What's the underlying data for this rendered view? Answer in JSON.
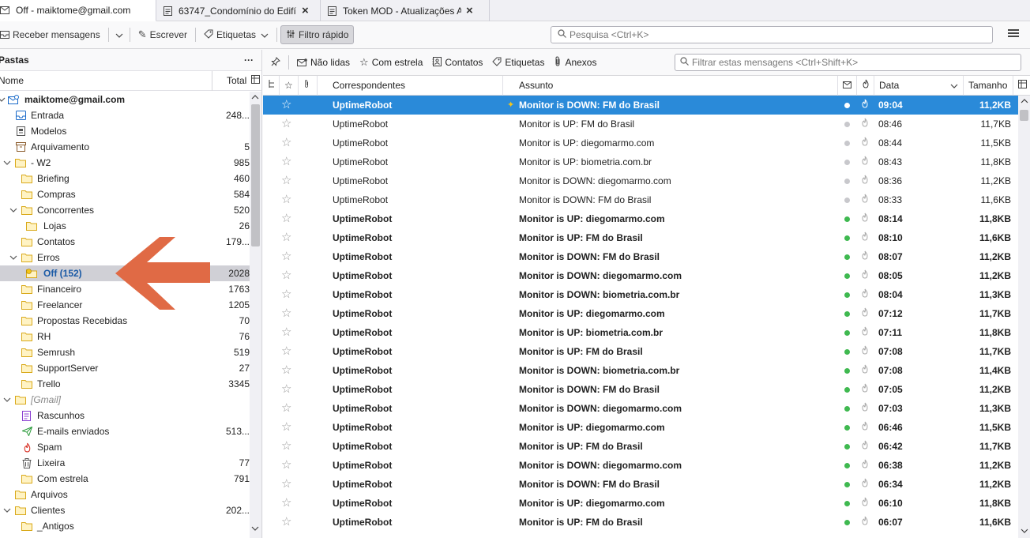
{
  "tabs": [
    {
      "label": "Off - maiktome@gmail.com",
      "icon": "mail-icon",
      "active": true
    },
    {
      "label": "63747_Condomínio do Edifí",
      "icon": "document-icon",
      "active": false
    },
    {
      "label": "Token MOD - Atualizações A",
      "icon": "document-icon",
      "active": false
    }
  ],
  "toolbar": {
    "get_messages": "Receber mensagens",
    "write": "Escrever",
    "tags": "Etiquetas",
    "quick_filter": "Filtro rápido",
    "search_placeholder": "Pesquisa <Ctrl+K>"
  },
  "folder_pane": {
    "title": "Pastas",
    "more": "···",
    "col_name": "Nome",
    "col_total": "Total",
    "folders": [
      {
        "name": "maiktome@gmail.com",
        "count": "",
        "icon": "account-icon",
        "twisty": "v",
        "indent": 0,
        "bold": true
      },
      {
        "name": "Entrada",
        "count": "248...",
        "icon": "inbox-icon",
        "twisty": "",
        "indent": 1
      },
      {
        "name": "Modelos",
        "count": "",
        "icon": "templates-icon",
        "twisty": "",
        "indent": 1
      },
      {
        "name": "Arquivamento",
        "count": "5",
        "icon": "archive-icon",
        "twisty": "",
        "indent": 1
      },
      {
        "name": "- W2",
        "count": "985",
        "icon": "folder-icon",
        "twisty": "v",
        "indent": 1
      },
      {
        "name": "Briefing",
        "count": "460",
        "icon": "folder-icon",
        "twisty": "",
        "indent": 2
      },
      {
        "name": "Compras",
        "count": "584",
        "icon": "folder-icon",
        "twisty": "",
        "indent": 2
      },
      {
        "name": "Concorrentes",
        "count": "520",
        "icon": "folder-icon",
        "twisty": "v",
        "indent": 2
      },
      {
        "name": "Lojas",
        "count": "26",
        "icon": "folder-icon",
        "twisty": "",
        "indent": 3
      },
      {
        "name": "Contatos",
        "count": "179...",
        "icon": "folder-icon",
        "twisty": "",
        "indent": 2
      },
      {
        "name": "Erros",
        "count": "",
        "icon": "folder-icon",
        "twisty": "v",
        "indent": 2
      },
      {
        "name": "Off (152)",
        "count": "2028",
        "icon": "folder-new-icon",
        "twisty": "",
        "indent": 3,
        "selected": true
      },
      {
        "name": "Financeiro",
        "count": "1763",
        "icon": "folder-icon",
        "twisty": "",
        "indent": 2
      },
      {
        "name": "Freelancer",
        "count": "1205",
        "icon": "folder-icon",
        "twisty": "",
        "indent": 2
      },
      {
        "name": "Propostas Recebidas",
        "count": "70",
        "icon": "folder-icon",
        "twisty": "",
        "indent": 2
      },
      {
        "name": "RH",
        "count": "76",
        "icon": "folder-icon",
        "twisty": "",
        "indent": 2
      },
      {
        "name": "Semrush",
        "count": "519",
        "icon": "folder-icon",
        "twisty": "",
        "indent": 2
      },
      {
        "name": "SupportServer",
        "count": "27",
        "icon": "folder-icon",
        "twisty": "",
        "indent": 2
      },
      {
        "name": "Trello",
        "count": "3345",
        "icon": "folder-icon",
        "twisty": "",
        "indent": 2
      },
      {
        "name": "[Gmail]",
        "count": "",
        "icon": "folder-icon",
        "twisty": "v",
        "indent": 1,
        "italic": true
      },
      {
        "name": "Rascunhos",
        "count": "",
        "icon": "drafts-icon",
        "twisty": "",
        "indent": 2
      },
      {
        "name": "E-mails enviados",
        "count": "513...",
        "icon": "sent-icon",
        "twisty": "",
        "indent": 2
      },
      {
        "name": "Spam",
        "count": "",
        "icon": "spam-icon",
        "twisty": "",
        "indent": 2
      },
      {
        "name": "Lixeira",
        "count": "77",
        "icon": "trash-icon",
        "twisty": "",
        "indent": 2
      },
      {
        "name": "Com estrela",
        "count": "791",
        "icon": "folder-icon",
        "twisty": "",
        "indent": 2
      },
      {
        "name": "Arquivos",
        "count": "",
        "icon": "folder-icon",
        "twisty": "",
        "indent": 1
      },
      {
        "name": "Clientes",
        "count": "202...",
        "icon": "folder-icon",
        "twisty": "v",
        "indent": 1
      },
      {
        "name": "_Antigos",
        "count": "",
        "icon": "folder-icon",
        "twisty": "",
        "indent": 2
      }
    ]
  },
  "quick_filter": {
    "unread": "Não lidas",
    "starred": "Com estrela",
    "contacts": "Contatos",
    "tags": "Etiquetas",
    "attachments": "Anexos",
    "filter_placeholder": "Filtrar estas mensagens <Ctrl+Shift+K>"
  },
  "columns": {
    "correspondents": "Correspondentes",
    "subject": "Assunto",
    "date": "Data",
    "size": "Tamanho"
  },
  "colors": {
    "selected_row": "#2a8ad9",
    "arrow": "#e06a45",
    "unread_dot": "#3fb950",
    "read_dot": "#c8c8cc"
  },
  "messages": [
    {
      "sender": "UptimeRobot",
      "subject": "Monitor is DOWN: FM do Brasil",
      "date": "09:04",
      "size": "11,2KB",
      "unread": true,
      "selected": true,
      "new": true
    },
    {
      "sender": "UptimeRobot",
      "subject": "Monitor is UP: FM do Brasil",
      "date": "08:46",
      "size": "11,7KB",
      "unread": false
    },
    {
      "sender": "UptimeRobot",
      "subject": "Monitor is UP: diegomarmo.com",
      "date": "08:44",
      "size": "11,5KB",
      "unread": false
    },
    {
      "sender": "UptimeRobot",
      "subject": "Monitor is UP: biometria.com.br",
      "date": "08:43",
      "size": "11,8KB",
      "unread": false
    },
    {
      "sender": "UptimeRobot",
      "subject": "Monitor is DOWN: diegomarmo.com",
      "date": "08:36",
      "size": "11,2KB",
      "unread": false
    },
    {
      "sender": "UptimeRobot",
      "subject": "Monitor is DOWN: FM do Brasil",
      "date": "08:33",
      "size": "11,6KB",
      "unread": false
    },
    {
      "sender": "UptimeRobot",
      "subject": "Monitor is UP: diegomarmo.com",
      "date": "08:14",
      "size": "11,8KB",
      "unread": true
    },
    {
      "sender": "UptimeRobot",
      "subject": "Monitor is UP: FM do Brasil",
      "date": "08:10",
      "size": "11,6KB",
      "unread": true
    },
    {
      "sender": "UptimeRobot",
      "subject": "Monitor is DOWN: FM do Brasil",
      "date": "08:07",
      "size": "11,2KB",
      "unread": true
    },
    {
      "sender": "UptimeRobot",
      "subject": "Monitor is DOWN: diegomarmo.com",
      "date": "08:05",
      "size": "11,2KB",
      "unread": true
    },
    {
      "sender": "UptimeRobot",
      "subject": "Monitor is DOWN: biometria.com.br",
      "date": "08:04",
      "size": "11,3KB",
      "unread": true
    },
    {
      "sender": "UptimeRobot",
      "subject": "Monitor is UP: diegomarmo.com",
      "date": "07:12",
      "size": "11,7KB",
      "unread": true
    },
    {
      "sender": "UptimeRobot",
      "subject": "Monitor is UP: biometria.com.br",
      "date": "07:11",
      "size": "11,8KB",
      "unread": true
    },
    {
      "sender": "UptimeRobot",
      "subject": "Monitor is UP: FM do Brasil",
      "date": "07:08",
      "size": "11,7KB",
      "unread": true
    },
    {
      "sender": "UptimeRobot",
      "subject": "Monitor is DOWN: biometria.com.br",
      "date": "07:08",
      "size": "11,4KB",
      "unread": true
    },
    {
      "sender": "UptimeRobot",
      "subject": "Monitor is DOWN: FM do Brasil",
      "date": "07:05",
      "size": "11,2KB",
      "unread": true
    },
    {
      "sender": "UptimeRobot",
      "subject": "Monitor is DOWN: diegomarmo.com",
      "date": "07:03",
      "size": "11,3KB",
      "unread": true
    },
    {
      "sender": "UptimeRobot",
      "subject": "Monitor is UP: diegomarmo.com",
      "date": "06:46",
      "size": "11,5KB",
      "unread": true
    },
    {
      "sender": "UptimeRobot",
      "subject": "Monitor is UP: FM do Brasil",
      "date": "06:42",
      "size": "11,7KB",
      "unread": true
    },
    {
      "sender": "UptimeRobot",
      "subject": "Monitor is DOWN: diegomarmo.com",
      "date": "06:38",
      "size": "11,2KB",
      "unread": true
    },
    {
      "sender": "UptimeRobot",
      "subject": "Monitor is DOWN: FM do Brasil",
      "date": "06:34",
      "size": "11,2KB",
      "unread": true
    },
    {
      "sender": "UptimeRobot",
      "subject": "Monitor is UP: diegomarmo.com",
      "date": "06:10",
      "size": "11,8KB",
      "unread": true
    },
    {
      "sender": "UptimeRobot",
      "subject": "Monitor is UP: FM do Brasil",
      "date": "06:07",
      "size": "11,6KB",
      "unread": true
    }
  ]
}
